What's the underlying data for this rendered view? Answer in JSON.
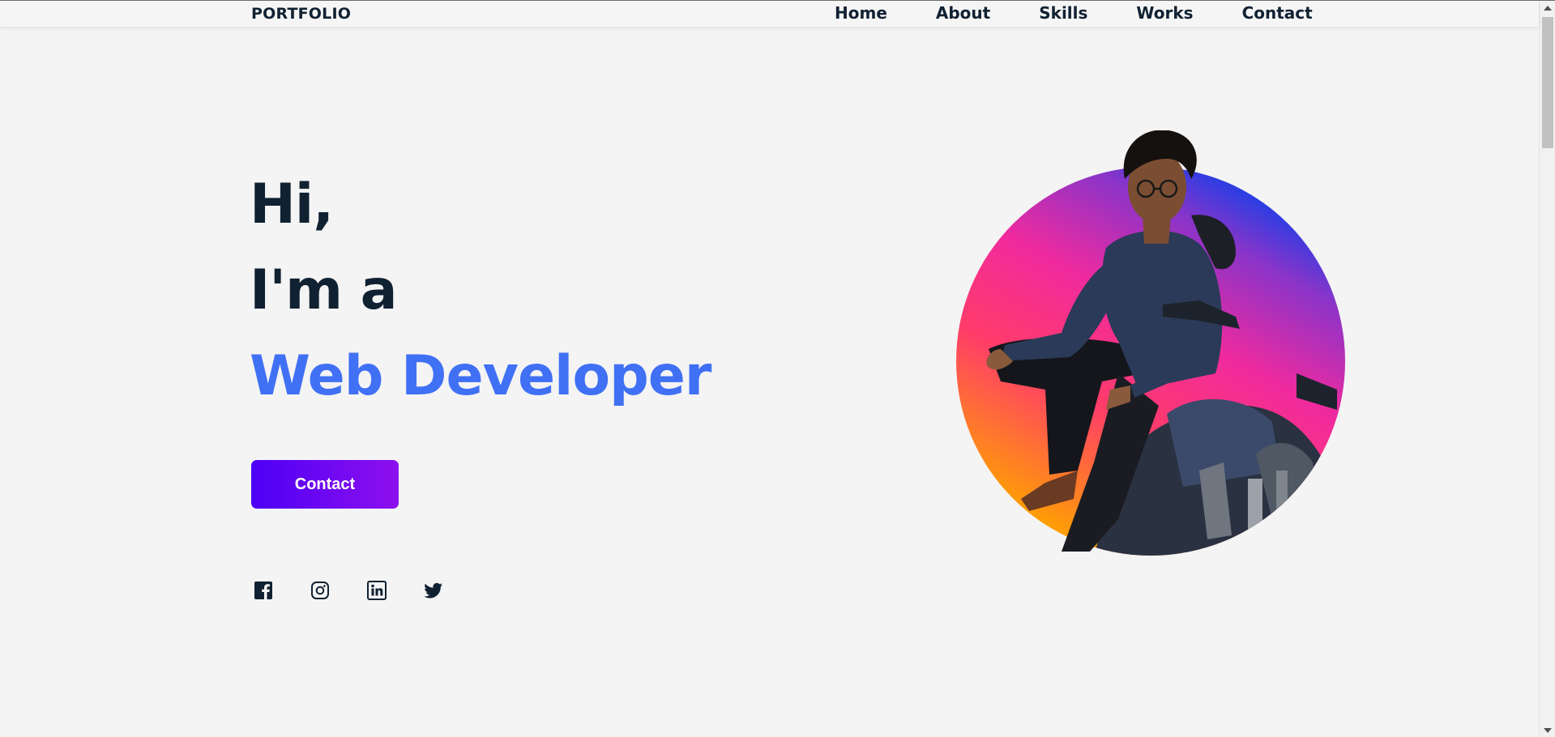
{
  "header": {
    "logo": "PORTFOLIO",
    "nav": [
      "Home",
      "About",
      "Skills",
      "Works",
      "Contact"
    ]
  },
  "hero": {
    "line1": "Hi,",
    "line2": "I'm a",
    "line3": "Web Developer",
    "contact_button": "Contact",
    "social_icons": [
      "facebook-icon",
      "instagram-icon",
      "linkedin-icon",
      "twitter-icon"
    ]
  },
  "colors": {
    "text": "#102132",
    "accent": "#4070f4",
    "button_gradient_start": "#4d00f5",
    "button_gradient_end": "#8e10ee",
    "background": "#f4f4f4"
  }
}
